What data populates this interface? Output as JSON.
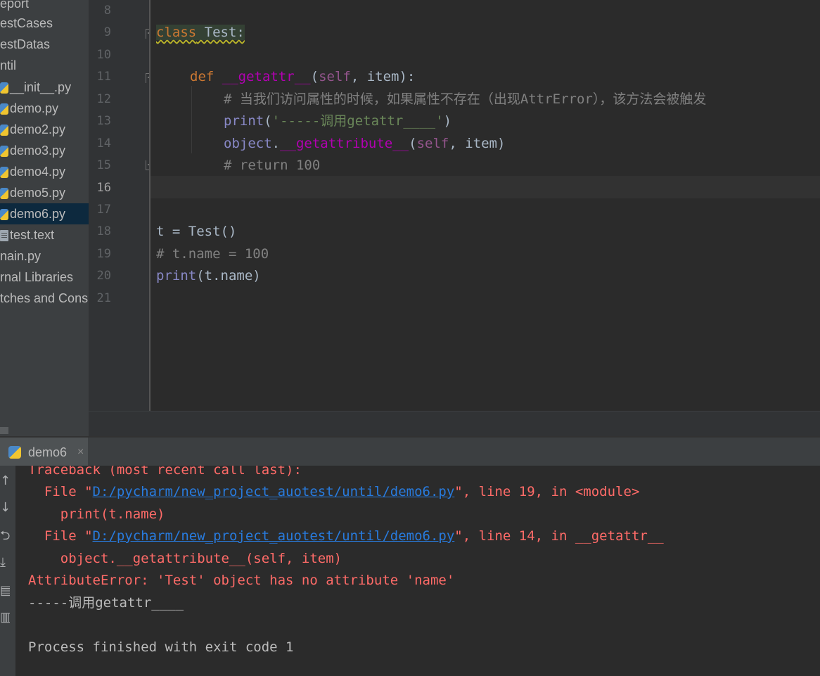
{
  "project_tree": {
    "items": [
      {
        "label": "eport",
        "icon": null
      },
      {
        "label": "estCases",
        "icon": null
      },
      {
        "label": "estDatas",
        "icon": null
      },
      {
        "label": "ntil",
        "icon": null
      },
      {
        "label": "__init__.py",
        "icon": "python-file-icon"
      },
      {
        "label": "demo.py",
        "icon": "python-file-icon"
      },
      {
        "label": "demo2.py",
        "icon": "python-file-icon"
      },
      {
        "label": "demo3.py",
        "icon": "python-file-icon"
      },
      {
        "label": "demo4.py",
        "icon": "python-file-icon"
      },
      {
        "label": "demo5.py",
        "icon": "python-file-icon"
      },
      {
        "label": "demo6.py",
        "icon": "python-file-icon",
        "selected": true
      },
      {
        "label": "test.text",
        "icon": "text-file-icon"
      },
      {
        "label": "nain.py",
        "icon": null
      },
      {
        "label": "rnal Libraries",
        "icon": null
      },
      {
        "label": "tches and Cons",
        "icon": null
      }
    ]
  },
  "editor": {
    "line_numbers": [
      "8",
      "9",
      "10",
      "11",
      "12",
      "13",
      "14",
      "15",
      "16",
      "17",
      "18",
      "19",
      "20",
      "21"
    ],
    "current_line": "16",
    "code": {
      "l9_kw": "class",
      "l9_name": " Test:",
      "l11_kw": "def",
      "l11_fn": "__getattr__",
      "l11_open": "(",
      "l11_self": "self",
      "l11_rest": ", item):",
      "l12_comment": "# 当我们访问属性的时候，如果属性不存在（出现AttrError），该方法会被触发",
      "l13_print": "print",
      "l13_open": "(",
      "l13_str": "'-----调用getattr____'",
      "l13_close": ")",
      "l14_obj": "object",
      "l14_dot": ".",
      "l14_fn": "__getattribute__",
      "l14_open": "(",
      "l14_self": "self",
      "l14_rest": ", item)",
      "l15_comment": "# return 100",
      "l18_code": "t = Test()",
      "l19_comment": "# t.name = 100",
      "l20_print": "print",
      "l20_rest": "(t.name)"
    }
  },
  "run_panel": {
    "tab_label": "demo6",
    "close_glyph": "×",
    "toolbar_icons": [
      "up-arrow-icon",
      "down-arrow-icon",
      "soft-wrap-icon",
      "scroll-to-end-icon",
      "print-icon",
      "trash-icon"
    ],
    "console": {
      "traceback_header": "Traceback (most recent call last):",
      "frame1_prefix": "  File \"",
      "frame1_path": "D:/pycharm/new_project_auotest/until/demo6.py",
      "frame1_suffix": "\", line 19, in <module>",
      "frame1_code": "    print(t.name)",
      "frame2_prefix": "  File \"",
      "frame2_path": "D:/pycharm/new_project_auotest/until/demo6.py",
      "frame2_suffix": "\", line 14, in __getattr__",
      "frame2_code": "    object.__getattribute__(self, item)",
      "error_line": "AttributeError: 'Test' object has no attribute 'name'",
      "stdout_line": "-----调用getattr____",
      "exit_line": "Process finished with exit code 1"
    }
  },
  "colors": {
    "editor_bg": "#2b2b2b",
    "keyword": "#cc7832",
    "dunder_method": "#b200b2",
    "self": "#94558d",
    "comment": "#808080",
    "string": "#6a8759",
    "error_text": "#ff6b68",
    "link": "#287bde",
    "selection": "#0d293e"
  }
}
